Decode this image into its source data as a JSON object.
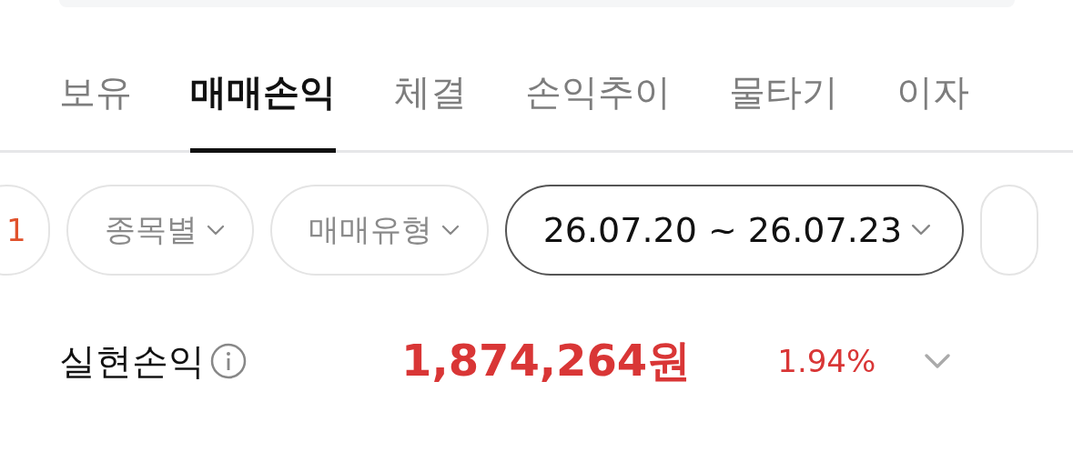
{
  "tabs": [
    {
      "label": "보유",
      "selected": false
    },
    {
      "label": "매매손익",
      "selected": true
    },
    {
      "label": "체결",
      "selected": false
    },
    {
      "label": "손익추이",
      "selected": false
    },
    {
      "label": "물타기",
      "selected": false
    },
    {
      "label": "이자",
      "selected": false
    }
  ],
  "filters": [
    {
      "label": "1",
      "kind": "count",
      "selected": false
    },
    {
      "label": "종목별",
      "kind": "dropdown",
      "selected": false
    },
    {
      "label": "매매유형",
      "kind": "dropdown",
      "selected": false
    },
    {
      "label": "26.07.20 ~ 26.07.23",
      "kind": "dropdown",
      "selected": true
    }
  ],
  "summary": {
    "label": "실현손익",
    "amount": "1,874,264원",
    "rate": "1.94%",
    "expanded": false
  }
}
